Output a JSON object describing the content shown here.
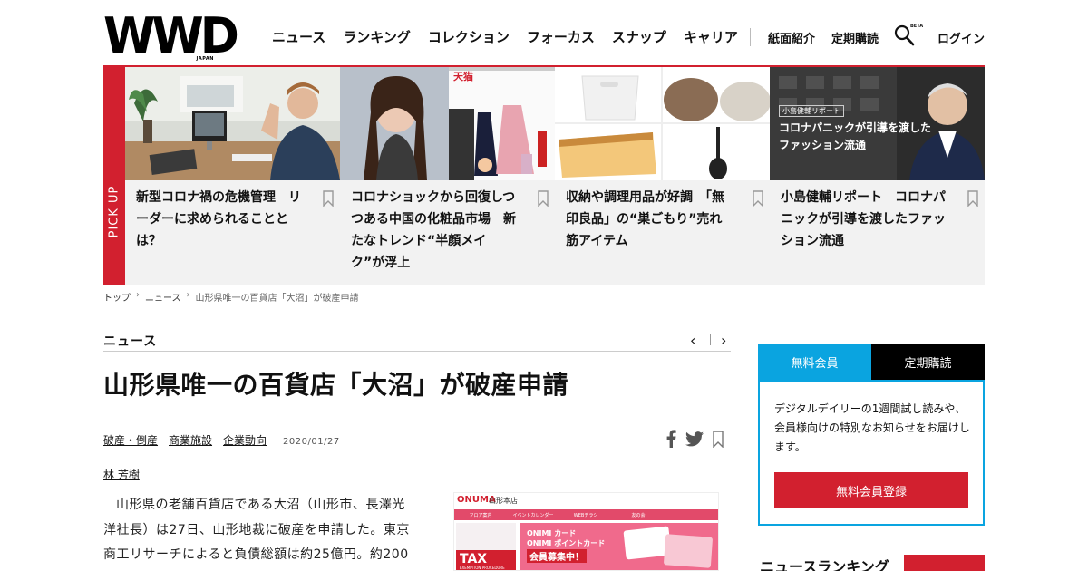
{
  "header": {
    "logo": "WWD",
    "logo_sub": "JAPAN",
    "nav": [
      "ニュース",
      "ランキング",
      "コレクション",
      "フォーカス",
      "スナップ",
      "キャリア"
    ],
    "nav_right": [
      "紙面紹介",
      "定期購読"
    ],
    "search_tag": "BETA",
    "login": "ログイン"
  },
  "pickup": {
    "label": "PICK UP",
    "cards": [
      {
        "title": "新型コロナ禍の危機管理　リーダーに求められることとは？"
      },
      {
        "title": "コロナショックから回復しつつある中国の化粧品市場　新たなトレンド“半顔メイク”が浮上"
      },
      {
        "title": "収納や調理用品が好調　「無印良品」の“巣ごもり”売れ筋アイテム"
      },
      {
        "title": "小島健輔リポート　コロナパニックが引導を渡したファッション流通",
        "overlay_tag": "小島健輔リポート",
        "overlay_title": "コロナパニックが引導を渡したファッション流通"
      }
    ]
  },
  "breadcrumb": {
    "items": [
      "トップ",
      "ニュース",
      "山形県唯一の百貨店「大沼」が破産申請"
    ],
    "sep": "›"
  },
  "article": {
    "section": "ニュース",
    "prev": "‹",
    "next": "›",
    "headline": "山形県唯一の百貨店「大沼」が破産申請",
    "tags": [
      "破産・倒産",
      "商業施設",
      "企業動向"
    ],
    "date": "2020/01/27",
    "author": "林 芳樹",
    "body": "山形県の老舗百貨店である大沼（山形市、長澤光洋社長）は27日、山形地裁に破産を申請した。東京商工リサーチによると負債総額は約25億円。約200"
  },
  "article_image": {
    "brand": "ONUMA",
    "store": "山形本店",
    "menu": [
      "フロア案内",
      "イベントカレンダー",
      "WEBチラシ",
      "友の会"
    ],
    "left_text": "TAX",
    "left_sub": "EXEMPTION PROCEDURE",
    "card_line1": "ONIMI カード",
    "card_line2": "ONIMI ポイントカード",
    "card_line3": "会員募集中！"
  },
  "sidebar": {
    "tab_free": "無料会員",
    "tab_sub": "定期購読",
    "member_text": "デジタルデイリーの1週間試し読みや、会員様向けの特別なお知らせをお届けします。",
    "register": "無料会員登録",
    "ranking_title": "ニュースランキング"
  },
  "colors": {
    "accent": "#d2202f",
    "blue": "#0aa4e0"
  }
}
